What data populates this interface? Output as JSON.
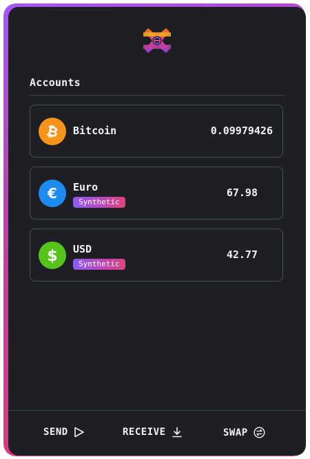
{
  "section_title": "Accounts",
  "accounts": [
    {
      "name": "Bitcoin",
      "value": "0.09979426",
      "icon": "bitcoin-icon",
      "color": "#f7931a"
    },
    {
      "name": "Euro",
      "badge": "Synthetic",
      "value": "67.98",
      "icon": "euro-icon",
      "color": "#1d8cf0"
    },
    {
      "name": "USD",
      "badge": "Synthetic",
      "value": "42.77",
      "icon": "dollar-icon",
      "color": "#55c41a"
    }
  ],
  "actions": [
    {
      "label": "SEND",
      "icon": "send-icon"
    },
    {
      "label": "RECEIVE",
      "icon": "download-icon"
    },
    {
      "label": "SWAP",
      "icon": "swap-icon"
    }
  ],
  "colors": {
    "background": "#1d1f24",
    "card_border": "#4a4d55",
    "accent_gradient": [
      "#a855f7",
      "#e8386f"
    ]
  }
}
